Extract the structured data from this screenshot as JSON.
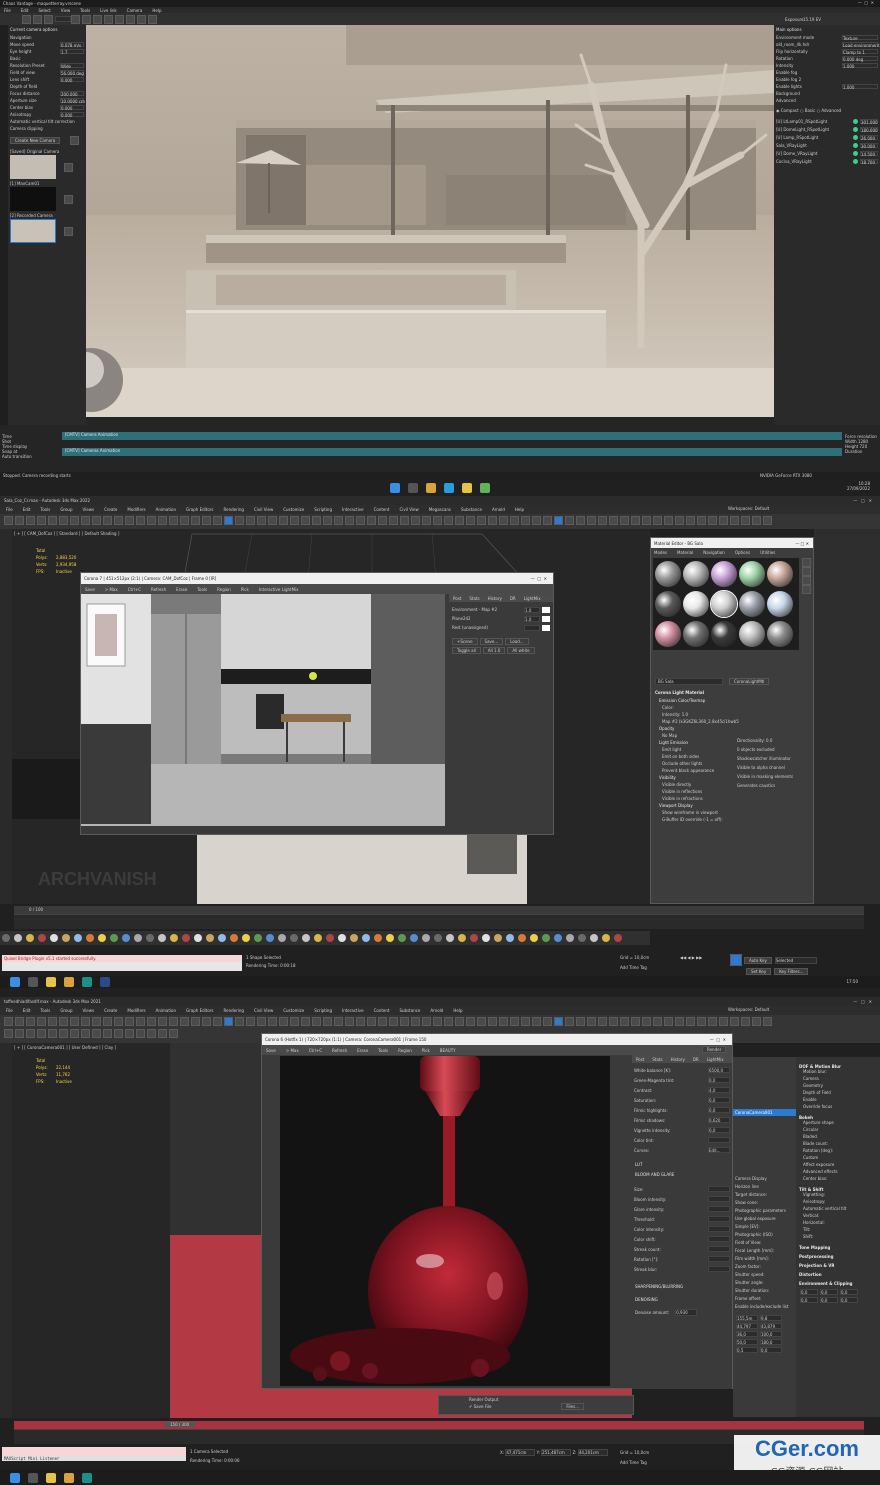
{
  "s1": {
    "title": "Chaos Vantage - maquetterray.vrscene",
    "menu": [
      "File",
      "Edit",
      "Select",
      "View",
      "Tools",
      "Live link",
      "Camera",
      "Help"
    ],
    "left_panel": {
      "header": "Current camera options",
      "rows": [
        [
          "Navigation",
          ""
        ],
        [
          "Move speed",
          "0.078 m/s"
        ],
        [
          "Eye height",
          "1.7"
        ],
        [
          "Basic",
          ""
        ],
        [
          "Resolution Preset",
          "Wide"
        ],
        [
          "Field of view",
          "56.000 deg"
        ],
        [
          "Lens shift",
          "0.000"
        ],
        [
          "Depth of field",
          ""
        ],
        [
          "Focus distance",
          "200.000"
        ],
        [
          "Aperture size",
          "10.0000 cm"
        ],
        [
          "Center bias",
          "0.000"
        ],
        [
          "Anisotropy",
          "0.000"
        ],
        [
          "Automatic vertical tilt correction",
          ""
        ],
        [
          "Camera clipping",
          ""
        ]
      ],
      "create_camera": "Create New Camera",
      "cameras": [
        "[Saved] Original Camera",
        "[1] MaxCam01",
        "[2] Recorded Camera"
      ]
    },
    "right_panel": {
      "exposure_label": "Exposure",
      "exposure_value": "15.19 EV",
      "header": "Main options",
      "rows": [
        [
          "Environment mode",
          "Texture"
        ],
        [
          "old_room_4k.hdr",
          "Load environment..."
        ],
        [
          "Flip horizontally",
          "Clamp to 1"
        ],
        [
          "Rotation",
          "0.000 deg"
        ],
        [
          "Intensity",
          "1.000"
        ],
        [
          "Enable fog",
          ""
        ],
        [
          "Enable fog 2",
          ""
        ],
        [
          "Enable lights",
          "1.000"
        ],
        [
          "Background",
          ""
        ],
        [
          "Advanced",
          ""
        ]
      ],
      "lights": [
        "[U] LtLamp01_RSpotLight",
        "[U] DomeLight_RSpotLight",
        "[U] Lamp_RSpotLight",
        "Sala_VRayLight",
        "[U] Dome_VRayLight",
        "Cocina_VRayLight"
      ],
      "light_values": [
        "301.000",
        "180.000",
        "26.000",
        "30.000",
        "14.500",
        "18.700"
      ]
    },
    "timeline": [
      "[CMTV] Camera Animation",
      "[CMTV] Cameras Animation"
    ],
    "bottom_left": [
      "Time",
      "Shot",
      "Time display",
      "Snap at",
      "Auto transition"
    ],
    "bottom_right": [
      "Force resolution",
      "Width 1280",
      "Height 720",
      "Duration"
    ],
    "status": "Stopped. Camera recording starts",
    "gpu": "NVIDIA GeForce RTX 3080",
    "time": "10:28",
    "date": "27/09/2022"
  },
  "s2": {
    "title": "Sala_Coz_Cr.max - Autodesk 3ds Max 2022",
    "menu": [
      "File",
      "Edit",
      "Tools",
      "Group",
      "Views",
      "Create",
      "Modifiers",
      "Animation",
      "Graph Editors",
      "Rendering",
      "Civil View",
      "Customize",
      "Scripting",
      "Interactive",
      "Content",
      "Civil View",
      "Megascans",
      "Substance",
      "Arnold",
      "Help"
    ],
    "workspace_label": "Workspaces:",
    "workspace_value": "Default",
    "viewport_label": "[ + ] [ CAM_DofCoz ] [ Standard ] [ Default Shading ]",
    "stats": [
      [
        "Total",
        ""
      ],
      [
        "Polys:",
        "2,883,520"
      ],
      [
        "Verts:",
        "2,934,958"
      ],
      [
        "FPS:",
        "Inactive"
      ]
    ],
    "vfb_title": "Corona 7 | 451×512px (2:1) | Camera: CAM_DofCoz | Frame 0 [IR]",
    "vfb_toolbar": [
      "Save",
      "> Max",
      "Ctrl+C",
      "Refresh",
      "Erase",
      "Tools",
      "Region",
      "Pick",
      "Interactive LightMix"
    ],
    "vfb_tabs": [
      "Post",
      "Stats",
      "History",
      "DR",
      "LightMix"
    ],
    "lightmix": [
      "Environment - Map #2",
      "Plane242",
      "Rest (unassigned)"
    ],
    "lightmix_values": [
      "1.0",
      "1.0",
      ""
    ],
    "lightmix_buttons": [
      "+Scene",
      "Save...",
      "Load...",
      "Toggle all",
      "All 1.0",
      "All white"
    ],
    "mat_title": "Material Editor - BG Sala",
    "mat_menu": [
      "Modes",
      "Material",
      "Navigation",
      "Options",
      "Utilities"
    ],
    "mat_name": "BG Sala",
    "mat_type": "CoronaLightMtl",
    "mat_section": "Corona Light Material",
    "mat_rows": [
      "Emission Color/Texmap",
      "Color:",
      "Intensity: 1.0",
      "Map #2 (k3GKZ6L360_2.8x45ci1hwb5fbw.JPR8rJhb67.jpg)",
      "Opacity",
      "No Map",
      "Light Emission",
      "Emit light",
      "Emit on both sides",
      "Occlude other lights",
      "Prevent black appearance",
      "Visibility",
      "Visible directly",
      "Visible in reflections",
      "Visible in refractions",
      "Viewport Display",
      "Show wireframe in viewport",
      "G-Buffer ID override (-1 = off):"
    ],
    "mat_right_rows": [
      "Directionality: 0.0",
      "0 objects excluded",
      "Shadowcatcher illuminator",
      "Visible to alpha channel",
      "Visible in masking elements",
      "Generates caustics"
    ],
    "frame": "0 / 100",
    "script": "Quixel Bridge Plugin v5.1 started successfully.",
    "status1": "1 Shape Selected",
    "status2": "Rendering Time: 0:00:18",
    "grid": "Grid = 10,0cm",
    "time": "17:50",
    "auto_key": "Auto Key",
    "selected": "Selected",
    "set_key": "Set Key",
    "key_filters": "Key Filters...",
    "add_time_tag": "Add Time Tag"
  },
  "s3": {
    "title": "toffeedhiadlfasdlf.max - Autodesk 3ds Max 2021",
    "menu": [
      "File",
      "Edit",
      "Tools",
      "Group",
      "Views",
      "Create",
      "Modifiers",
      "Animation",
      "Graph Editors",
      "Rendering",
      "Civil View",
      "Customize",
      "Scripting",
      "Interactive",
      "Content",
      "Substance",
      "Arnold",
      "Help"
    ],
    "workspace_label": "Workspaces:",
    "workspace_value": "Default",
    "viewport_label": "[ + ] [ CoronaCamera001 ] [ User Defined ] [ Clay ]",
    "stats": [
      [
        "Total",
        ""
      ],
      [
        "Polys:",
        "22,144"
      ],
      [
        "Verts:",
        "11,762"
      ],
      [
        "FPS:",
        "Inactive"
      ]
    ],
    "vfb_title": "Corona 6 (Hotfix 1) | 720×720px (1:1) | Camera: CoronaCamera001 | Frame 150",
    "vfb_toolbar": [
      "Save",
      "> Max",
      "Ctrl+C",
      "Refresh",
      "Erase",
      "Tools",
      "Region",
      "Pick",
      "BEAUTY"
    ],
    "vfb_render": "Render",
    "vfb_tabs": [
      "Post",
      "Stats",
      "History",
      "DR",
      "LightMix"
    ],
    "post_rows": [
      [
        "White balance [K]:",
        "6500,0"
      ],
      [
        "Green-Magenta tint:",
        "0,0"
      ],
      [
        "Contrast:",
        "4,0"
      ],
      [
        "Saturation:",
        "0,0"
      ],
      [
        "Filmic highlights:",
        "0,0"
      ],
      [
        "Filmic shadows:",
        "0,620"
      ],
      [
        "Vignette intensity:",
        "0,0"
      ],
      [
        "Color tint:",
        ""
      ],
      [
        "Curves:",
        "Edit..."
      ]
    ],
    "lut": "LUT",
    "bloom": "BLOOM AND GLARE",
    "bloom_rows": [
      "Size:",
      "Bloom intensity:",
      "Glare intensity:",
      "Threshold:",
      "Color intensity:",
      "Color shift:",
      "Streak count:",
      "Rotation [°]:",
      "Streak blur:"
    ],
    "sharpen": "SHARPENING/BLURRING",
    "denoise": "DENOISING",
    "denoise_label": "Denoise amount:",
    "denoise_value": "0,930",
    "right_sections": [
      "DOF & Motion Blur",
      "Bokeh",
      "Tilt & Shift",
      "Tone Mapping",
      "Postprocessing",
      "Projection & VR",
      "Distortion",
      "Environment & Clipping"
    ],
    "right_rows": [
      "Motion blur:",
      "Camera",
      "Geometry",
      "Depth of Field",
      "Enable",
      "Override focus",
      "Aperture shape",
      "Circular",
      "Bladed",
      "Blade count:",
      "Rotation [deg]:",
      "Custom",
      "Affect exposure",
      "Advanced effects",
      "Center bias:",
      "Vignetting:",
      "Anisotropy:",
      "Automatic vertical tilt",
      "Vertical:",
      "Horizontal:",
      "Tilt:",
      "Shift:"
    ],
    "right_values": [
      "0,0",
      "0,0",
      "0,0",
      "0,0",
      "0,0",
      "0,0"
    ],
    "render_output": "Render Output",
    "save_file": "Save File",
    "files_btn": "Files...",
    "camera_item": "CoronaCamera001",
    "middle_rows": [
      "Camera Display",
      "Horizon line",
      "Target distance:",
      "Show cone:",
      "Photographic parameters",
      "Use global exposure",
      "Simple [EV]:",
      "Photographic (ISO)",
      "Field of View:",
      "Focal Length [mm]:",
      "Film width [mm]:",
      "Zoom factor:",
      "Shutter speed:",
      "Shutter angle:",
      "Shutter duration:",
      "Frame offset:",
      "Enable include/exclude list"
    ],
    "middle_values": [
      "155,5m",
      "9,8",
      "44,797",
      "43,879",
      "36,0",
      "100,0",
      "50,0",
      "180,0",
      "0,5",
      "0,0"
    ],
    "frame": "150 / 300",
    "script": "MAXScript Mini Listener",
    "status1": "1 Camera Selected",
    "status2": "Rendering Time: 0:00:06",
    "grid": "Grid = 10,0cm",
    "coords": [
      "47,471cm",
      "251,487cm",
      "44,201cm"
    ],
    "add_time_tag": "Add Time Tag",
    "watermark": "CGer.com",
    "watermark_sub": "CG资源  CG网站"
  },
  "colors": {
    "chrome": "#2b2b2b",
    "dark": "#1e1e1e",
    "panel": "#444444",
    "accent": "#2c7bd3",
    "teal": "#2f6f7a",
    "red_floor": "#b33a44",
    "wine": "#8a1420"
  }
}
